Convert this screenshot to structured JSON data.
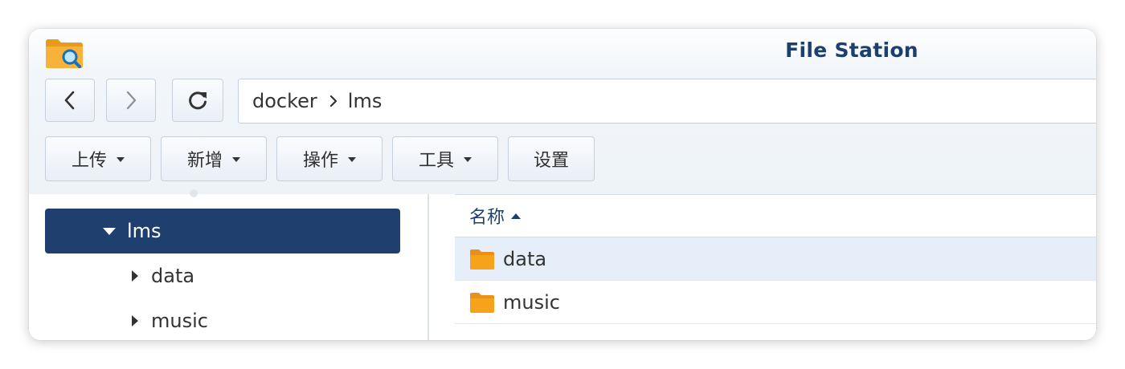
{
  "window": {
    "title": "File Station",
    "app_icon": "file-station-folder-magnifier-icon"
  },
  "nav": {
    "back_icon": "chevron-left-icon",
    "forward_icon": "chevron-right-icon",
    "refresh_icon": "refresh-icon"
  },
  "path": {
    "segments": [
      "docker",
      "lms"
    ],
    "separator_icon": "chevron-right-icon"
  },
  "toolbar": {
    "upload_label": "上传",
    "create_label": "新增",
    "action_label": "操作",
    "tools_label": "工具",
    "settings_label": "设置"
  },
  "tree": {
    "selected": {
      "label": "lms",
      "expanded": true
    },
    "children": [
      {
        "label": "data",
        "expanded": false
      },
      {
        "label": "music",
        "expanded": false
      }
    ]
  },
  "list": {
    "column_name": "名称",
    "sort": "ascending",
    "rows": [
      {
        "name": "data",
        "type": "folder",
        "highlighted": true
      },
      {
        "name": "music",
        "type": "folder",
        "highlighted": false
      }
    ]
  },
  "colors": {
    "selected_bg": "#1f3f6e",
    "title_color": "#1d3f6e",
    "folder": "#f7a21b",
    "row_highlight": "#e6eef9"
  }
}
